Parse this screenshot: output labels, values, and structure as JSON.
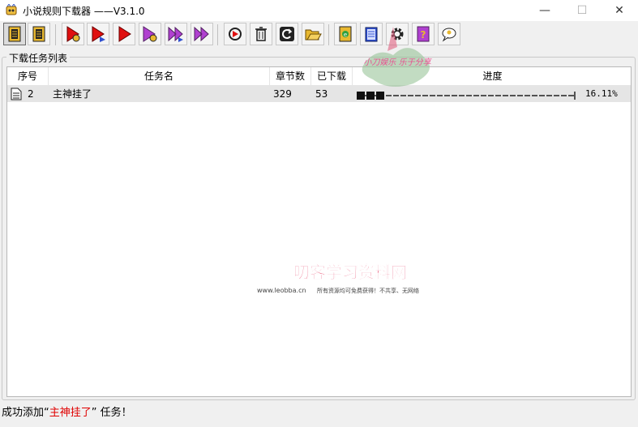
{
  "window": {
    "title": "小说规则下载器    ——V3.1.0",
    "minimize_glyph": "—",
    "maximize_glyph": "☐",
    "close_glyph": "✕"
  },
  "toolbar": {
    "buttons": [
      {
        "name": "rule-list-icon",
        "active": true
      },
      {
        "name": "task-list-icon",
        "active": false
      },
      {
        "name": "start-with-settings-icon",
        "active": false
      },
      {
        "name": "start-next-icon",
        "active": false
      },
      {
        "name": "start-icon",
        "active": false
      },
      {
        "name": "start-all-settings-icon",
        "active": false
      },
      {
        "name": "fast-forward-icon",
        "active": false
      },
      {
        "name": "skip-all-icon",
        "active": false
      },
      {
        "name": "replay-icon",
        "active": false
      },
      {
        "name": "delete-icon",
        "active": false
      },
      {
        "name": "refresh-icon",
        "active": false
      },
      {
        "name": "folder-open-icon",
        "active": false
      },
      {
        "name": "ebook-icon",
        "active": false
      },
      {
        "name": "notebook-icon",
        "active": false
      },
      {
        "name": "gear-icon",
        "active": false
      },
      {
        "name": "help-icon",
        "active": false
      },
      {
        "name": "chat-icon",
        "active": false
      }
    ],
    "colors": {
      "play": "#e01010",
      "settings": "#b040d0",
      "folder": "#e8b830"
    }
  },
  "tasks_panel": {
    "title": "下载任务列表",
    "columns": {
      "index": "序号",
      "name": "任务名",
      "chapters": "章节数",
      "downloaded": "已下载",
      "progress": "进度"
    },
    "rows": [
      {
        "index": "2",
        "name": "主神挂了",
        "chapters": "329",
        "downloaded": "53",
        "progress_percent": 16.11,
        "progress_label": "16.11%"
      }
    ]
  },
  "watermark": {
    "title": "叨客学习资料网",
    "url": "www.leobba.cn",
    "tagline": "所有资源均可免费获得！不共享、无网络"
  },
  "stamp": {
    "text": "小刀娱乐  乐于分享"
  },
  "status": {
    "prefix": "成功添加“",
    "highlight": "主神挂了",
    "suffix": "” 任务！",
    "highlight_color": "#e00000"
  }
}
